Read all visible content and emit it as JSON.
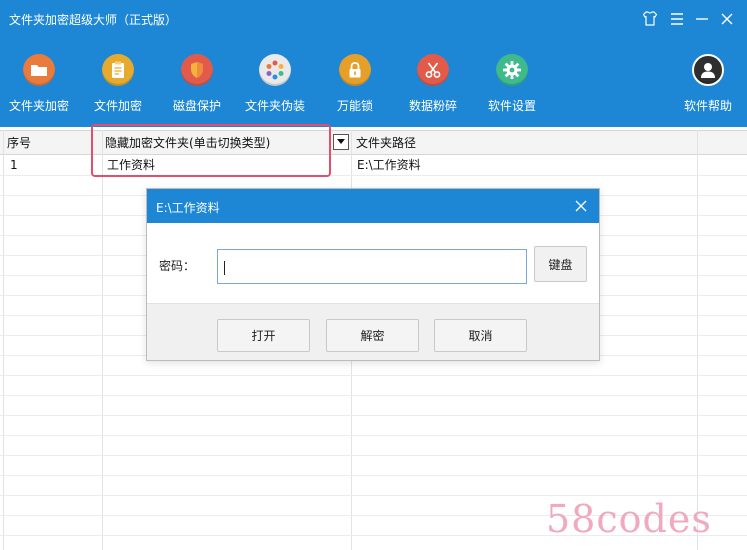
{
  "window": {
    "title": "文件夹加密超级大师（正式版）",
    "controls": [
      {
        "name": "skin-icon"
      },
      {
        "name": "menu-icon"
      },
      {
        "name": "minimize-icon"
      },
      {
        "name": "close-icon"
      }
    ]
  },
  "toolbar": {
    "items": [
      {
        "label": "文件夹加密",
        "icon": "folder-icon",
        "color": "#e97c3c"
      },
      {
        "label": "文件加密",
        "icon": "document-icon",
        "color": "#e6ab2e"
      },
      {
        "label": "磁盘保护",
        "icon": "shield-icon",
        "color": "#e25b4a"
      },
      {
        "label": "文件夹伪装",
        "icon": "disguise-wheel-icon",
        "color": "#d8d8d8"
      },
      {
        "label": "万能锁",
        "icon": "padlock-icon",
        "color": "#e6a02a"
      },
      {
        "label": "数据粉碎",
        "icon": "scissors-icon",
        "color": "#e25b4a"
      },
      {
        "label": "软件设置",
        "icon": "gear-icon",
        "color": "#3fba8c"
      }
    ],
    "help": {
      "label": "软件帮助",
      "icon": "user-help-icon",
      "color": "#444444"
    }
  },
  "table": {
    "headers": {
      "index": "序号",
      "hidden_folder": "隐藏加密文件夹(单击切换类型)",
      "path": "文件夹路径"
    },
    "rows": [
      {
        "index": "1",
        "name": "工作资料",
        "path": "E:\\工作资料"
      }
    ]
  },
  "dialog": {
    "title": "E:\\工作资料",
    "password_label": "密码：",
    "password_value": "",
    "keyboard_button": "键盘",
    "buttons": {
      "open": "打开",
      "decrypt": "解密",
      "cancel": "取消"
    }
  },
  "watermark": "58codes",
  "colors": {
    "accent": "#1d87d6",
    "highlight": "#e0506e"
  }
}
